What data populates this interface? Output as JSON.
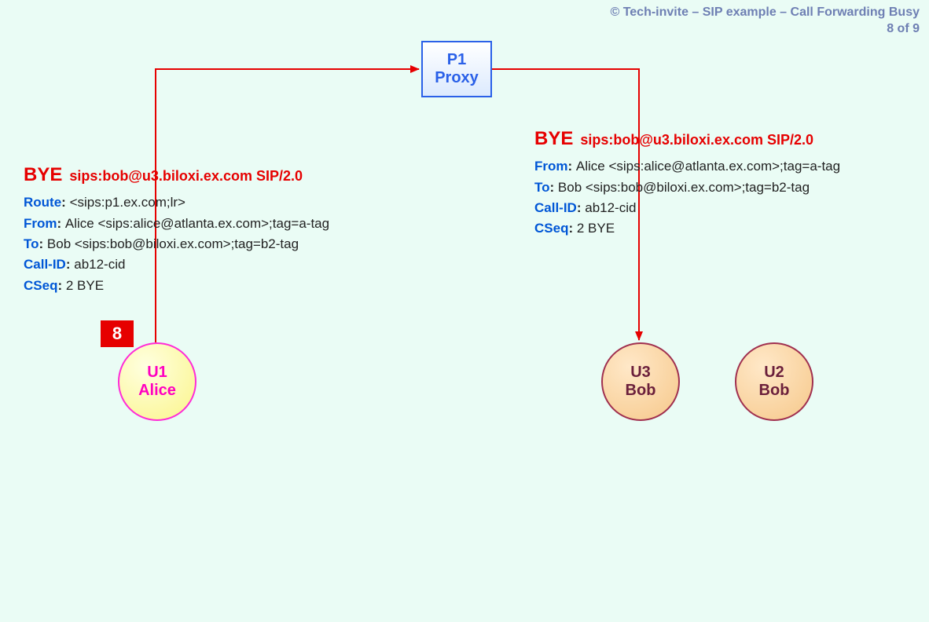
{
  "copyright": {
    "line1": "© Tech-invite – SIP example – Call Forwarding Busy",
    "line2": "8 of 9"
  },
  "proxy": {
    "l1": "P1",
    "l2": "Proxy"
  },
  "nodes": {
    "alice": {
      "l1": "U1",
      "l2": "Alice"
    },
    "bob3": {
      "l1": "U3",
      "l2": "Bob"
    },
    "bob2": {
      "l1": "U2",
      "l2": "Bob"
    }
  },
  "step_badge": "8",
  "msg_left": {
    "method": "BYE",
    "req_rest": "sips:bob@u3.biloxi.ex.com SIP/2.0",
    "headers": [
      {
        "name": "Route",
        "value": "<sips:p1.ex.com;lr>"
      },
      {
        "name": "From",
        "value": "Alice <sips:alice@atlanta.ex.com>;tag=a-tag"
      },
      {
        "name": "To",
        "value": "Bob <sips:bob@biloxi.ex.com>;tag=b2-tag"
      },
      {
        "name": "Call-ID",
        "value": "ab12-cid"
      },
      {
        "name": "CSeq",
        "value": "2 BYE"
      }
    ]
  },
  "msg_right": {
    "method": "BYE",
    "req_rest": "sips:bob@u3.biloxi.ex.com SIP/2.0",
    "headers": [
      {
        "name": "From",
        "value": "Alice <sips:alice@atlanta.ex.com>;tag=a-tag"
      },
      {
        "name": "To",
        "value": "Bob <sips:bob@biloxi.ex.com>;tag=b2-tag"
      },
      {
        "name": "Call-ID",
        "value": "ab12-cid"
      },
      {
        "name": "CSeq",
        "value": "2 BYE"
      }
    ]
  }
}
